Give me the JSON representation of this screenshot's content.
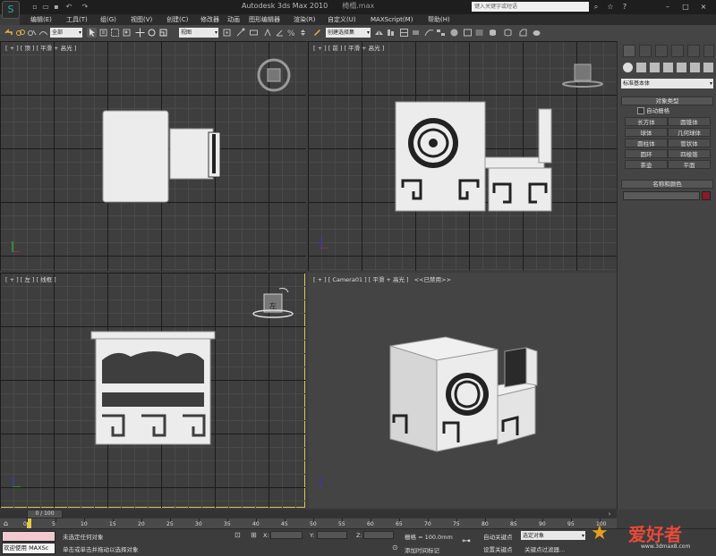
{
  "titlebar": {
    "app_title": "Autodesk 3ds Max  2010",
    "file_name": "椅榻.max",
    "search_placeholder": "键入关键字或短语"
  },
  "menubar": {
    "items": [
      "编辑(E)",
      "工具(T)",
      "组(G)",
      "视图(V)",
      "创建(C)",
      "修改器",
      "动画",
      "图形编辑器",
      "渲染(R)",
      "自定义(U)",
      "MAXScript(M)",
      "帮助(H)"
    ]
  },
  "toolbar": {
    "selection_filter": "全部",
    "reference_coord": "视图",
    "named_selection": "创建选择集"
  },
  "viewports": {
    "top": "[ + ] [ 顶 ] [ 平滑 + 高光 ]",
    "front": "[ + ] [ 前 ] [ 平滑 + 高光 ]",
    "left": "[ + ] [ 左 ] [ 线框 ]",
    "camera": "[ + ] [ Camera01 ] [ 平滑 + 高光 ]",
    "camera_disabled": "<<已禁用>>",
    "viewcube_left_face": "左"
  },
  "command_panel": {
    "category_dropdown": "标准基本体",
    "object_type_title": "对象类型",
    "autogrid_label": "自动栅格",
    "buttons": [
      "长方体",
      "圆锥体",
      "球体",
      "几何球体",
      "圆柱体",
      "管状体",
      "圆环",
      "四棱锥",
      "茶壶",
      "平面"
    ],
    "name_color_title": "名称和颜色",
    "color_swatch": "#8a1a2a"
  },
  "timeline": {
    "frame_counter": "0 / 100",
    "ticks": [
      "0",
      "5",
      "10",
      "15",
      "20",
      "25",
      "30",
      "35",
      "40",
      "45",
      "50",
      "55",
      "60",
      "65",
      "70",
      "75",
      "80",
      "85",
      "90",
      "95",
      "100"
    ]
  },
  "status": {
    "maxscript_listener": "欢迎使用 MAXSc",
    "selection_status": "未选定任何对象",
    "prompt": "单击或单击并拖动以选择对象",
    "x_label": "X:",
    "y_label": "Y:",
    "z_label": "Z:",
    "grid_label": "栅格 = 100.0mm",
    "add_time_tag": "添加时间标记",
    "autokey_label": "自动关键点",
    "selected_object": "选定对象",
    "set_key_label": "设置关键点",
    "key_filter": "关键点过滤器...",
    "watermark": "爱好者",
    "watermark_url": "www.3dmax8.com"
  },
  "colors": {
    "viewport_bg": "#3e3e3e",
    "active_viewport_border": "#d8c860",
    "model_color": "#ececec"
  }
}
